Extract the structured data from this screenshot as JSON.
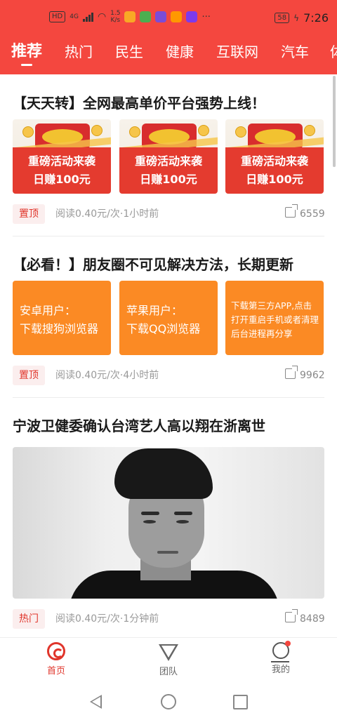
{
  "status_bar": {
    "hd": "HD",
    "network": "4G",
    "speed_value": "1.5",
    "speed_unit": "K/s",
    "battery": "58",
    "time": "7:26",
    "more": "···"
  },
  "tabs": [
    {
      "label": "推荐",
      "active": true
    },
    {
      "label": "热门"
    },
    {
      "label": "民生"
    },
    {
      "label": "健康"
    },
    {
      "label": "互联网"
    },
    {
      "label": "汽车"
    },
    {
      "label": "体"
    }
  ],
  "articles": [
    {
      "title": "【天天转】全网最高单价平台强势上线！",
      "images": [
        {
          "line1": "重磅活动来袭",
          "line2": "日赚100元"
        },
        {
          "line1": "重磅活动来袭",
          "line2": "日赚100元"
        },
        {
          "line1": "重磅活动来袭",
          "line2": "日赚100元"
        }
      ],
      "tag": "置顶",
      "read_label": "阅读",
      "read_price": "0.40元/次",
      "time": "·1小时前",
      "share_count": "6559"
    },
    {
      "title": "【必看！】朋友圈不可见解决方法，长期更新",
      "images": [
        {
          "text": "安卓用户：\n下载搜狗浏览器"
        },
        {
          "text": "苹果用户：\n下载QQ浏览器"
        },
        {
          "text": "下载第三方APP,点击打开重启手机或者清理后台进程再分享"
        }
      ],
      "tag": "置顶",
      "read_label": "阅读",
      "read_price": "0.40元/次",
      "time": "·4小时前",
      "share_count": "9962"
    },
    {
      "title": "宁波卫健委确认台湾艺人高以翔在浙离世",
      "tag": "热门",
      "read_label": "阅读",
      "read_price": "0.40元/次",
      "time": "·1分钟前",
      "share_count": "8489"
    }
  ],
  "bottom_nav": [
    {
      "label": "首页",
      "icon": "home-icon",
      "active": true
    },
    {
      "label": "团队",
      "icon": "diamond-icon"
    },
    {
      "label": "我的",
      "icon": "profile-icon"
    }
  ],
  "colors": {
    "brand": "#f4473f",
    "tag_text": "#e0352b",
    "orange_tile": "#fb8a24"
  }
}
